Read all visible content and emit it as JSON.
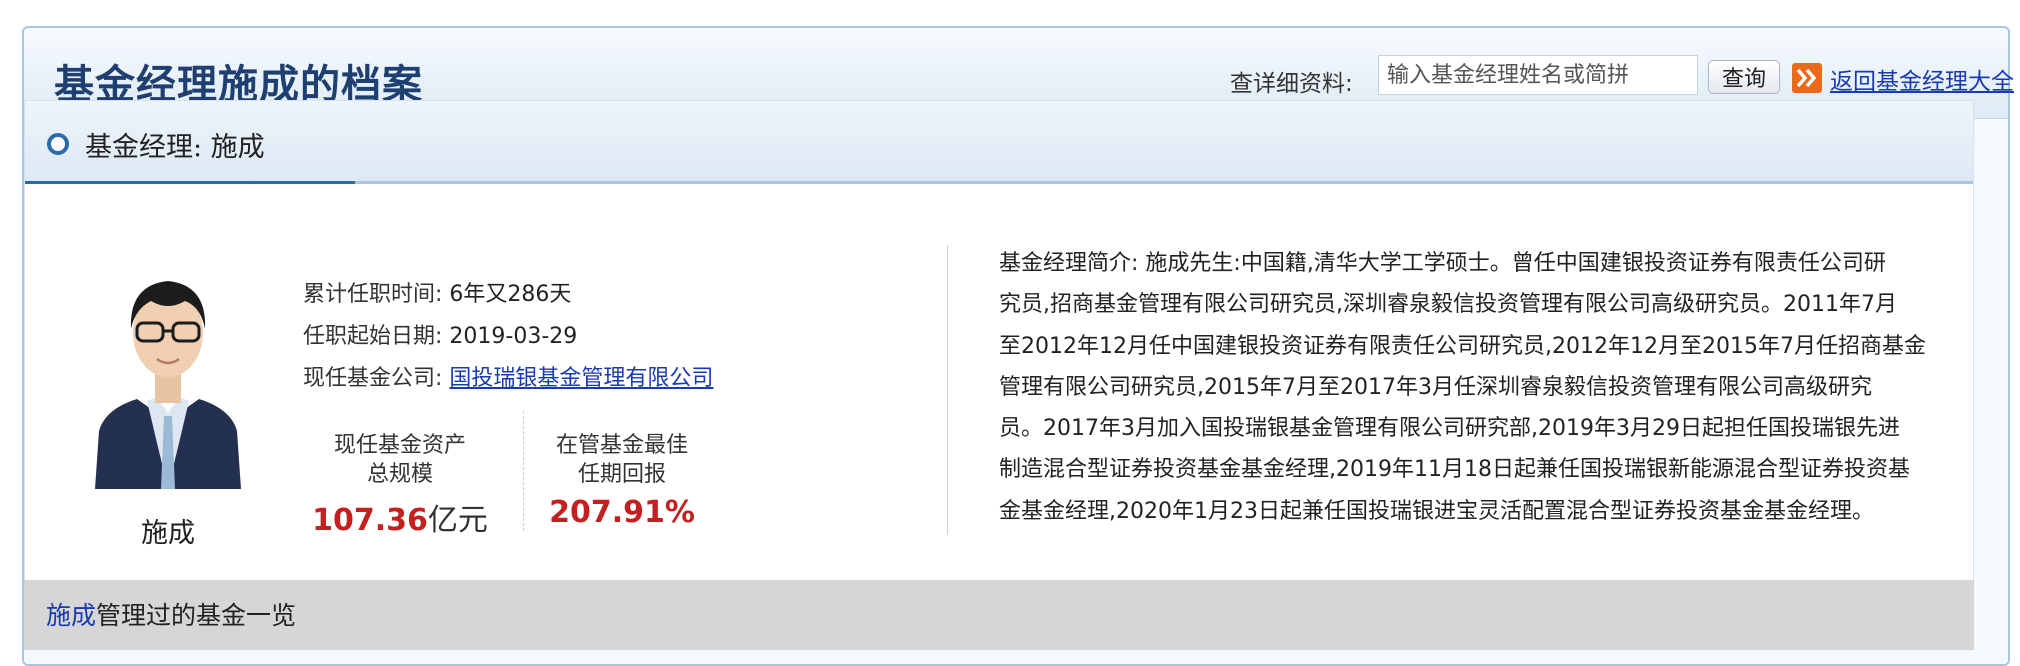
{
  "header": {
    "title": "基金经理施成的档案",
    "search_label": "查详细资料:",
    "search_placeholder": "输入基金经理姓名或简拼",
    "query_button": "查询",
    "return_link": "返回基金经理大全"
  },
  "section": {
    "title": "基金经理: 施成"
  },
  "manager": {
    "name": "施成",
    "tenure_label": "累计任职时间:",
    "tenure_value": "6年又286天",
    "start_label": "任职起始日期:",
    "start_value": "2019-03-29",
    "company_label": "现任基金公司:",
    "company_value": "国投瑞银基金管理有限公司"
  },
  "stats": {
    "asset_label_1": "现任基金资产",
    "asset_label_2": "总规模",
    "asset_value": "107.36",
    "asset_unit": "亿元",
    "return_label_1": "在管基金最佳",
    "return_label_2": "任期回报",
    "return_value": "207.91%"
  },
  "bio": {
    "lines": [
      "基金经理简介: 施成先生:中国籍,清华大学工学硕士。曾任中国建银投资证券有限责任公司研",
      "究员,招商基金管理有限公司研究员,深圳睿泉毅信投资管理有限公司高级研究员。2011年7月",
      "至2012年12月任中国建银投资证券有限责任公司研究员,2012年12月至2015年7月任招商基金",
      "管理有限公司研究员,2015年7月至2017年3月任深圳睿泉毅信投资管理有限公司高级研究",
      "员。2017年3月加入国投瑞银基金管理有限公司研究部,2019年3月29日起担任国投瑞银先进",
      "制造混合型证券投资基金基金经理,2019年11月18日起兼任国投瑞银新能源混合型证券投资基",
      "金基金经理,2020年1月23日起兼任国投瑞银进宝灵活配置混合型证券投资基金基金经理。"
    ]
  },
  "funds_section": {
    "name": "施成",
    "suffix": "管理过的基金一览"
  }
}
